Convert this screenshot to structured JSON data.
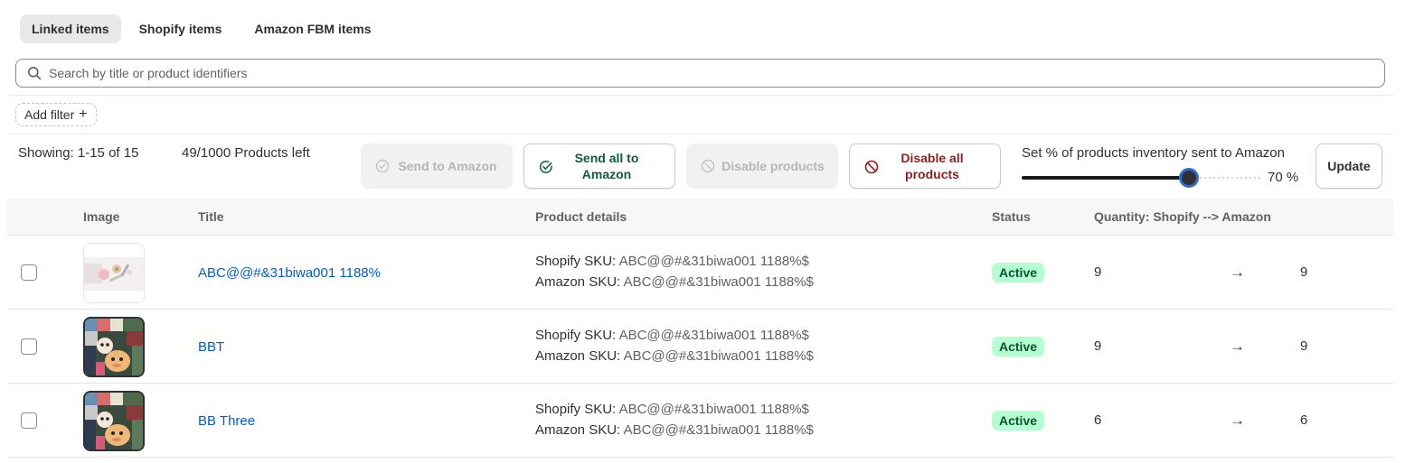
{
  "tabs": [
    {
      "label": "Linked items",
      "active": true
    },
    {
      "label": "Shopify items",
      "active": false
    },
    {
      "label": "Amazon FBM items",
      "active": false
    }
  ],
  "search": {
    "placeholder": "Search by title or product identifiers",
    "value": ""
  },
  "filter": {
    "add_label": "Add filter",
    "plus": "+"
  },
  "summary": {
    "showing": "Showing: 1-15 of 15",
    "products_left": "49/1000 Products left"
  },
  "actions": {
    "send_to_amazon": "Send to Amazon",
    "send_all_line1": "Send all to",
    "send_all_line2": "Amazon",
    "disable_products": "Disable products",
    "disable_all_line1": "Disable all",
    "disable_all_line2": "products",
    "update": "Update"
  },
  "inventory_slider": {
    "label": "Set % of products inventory sent to Amazon",
    "percent": 70,
    "value_text": "70 %"
  },
  "table": {
    "headers": {
      "image": "Image",
      "title": "Title",
      "details": "Product details",
      "status": "Status",
      "quantity": "Quantity: Shopify --> Amazon"
    },
    "rows": [
      {
        "title": "ABC@@#&31biwa001 1188%",
        "shopify_sku_label": "Shopify SKU:",
        "shopify_sku": "ABC@@#&31biwa001 1188%$",
        "amazon_sku_label": "Amazon SKU:",
        "amazon_sku": "ABC@@#&31biwa001 1188%$",
        "status": "Active",
        "qty_shopify": "9",
        "arrow": "→",
        "qty_amazon": "9",
        "checked": false
      },
      {
        "title": "BBT",
        "shopify_sku_label": "Shopify SKU:",
        "shopify_sku": "ABC@@#&31biwa001 1188%$",
        "amazon_sku_label": "Amazon SKU:",
        "amazon_sku": "ABC@@#&31biwa001 1188%$",
        "status": "Active",
        "qty_shopify": "9",
        "arrow": "→",
        "qty_amazon": "9",
        "checked": false
      },
      {
        "title": "BB Three",
        "shopify_sku_label": "Shopify SKU:",
        "shopify_sku": "ABC@@#&31biwa001 1188%$",
        "amazon_sku_label": "Amazon SKU:",
        "amazon_sku": "ABC@@#&31biwa001 1188%$",
        "status": "Active",
        "qty_shopify": "6",
        "arrow": "→",
        "qty_amazon": "6",
        "checked": false
      }
    ]
  },
  "colors": {
    "link": "#005bd3",
    "badge_bg": "#b4fed2",
    "badge_text": "#0c5132",
    "slider_thumb_border": "#2c6ecb",
    "send_all": "#0b5d3b",
    "disable_all": "#8e1f1f"
  }
}
